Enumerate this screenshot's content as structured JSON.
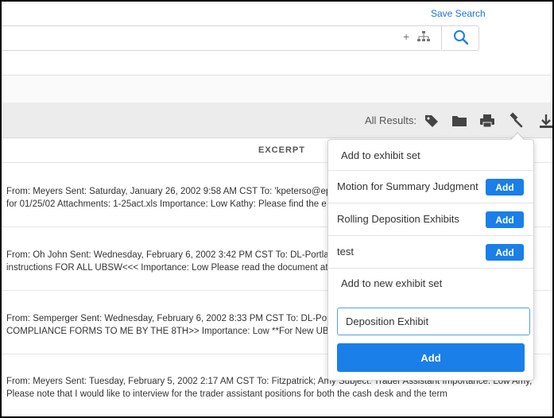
{
  "search": {
    "save_search_label": "Save Search",
    "query": "",
    "tools": {
      "add_symbol": "+"
    }
  },
  "toolbar": {
    "all_results_label": "All Results:",
    "icons": [
      "tags-icon",
      "folder-icon",
      "print-icon",
      "gavel-icon",
      "download-icon"
    ]
  },
  "table": {
    "excerpt_header": "EXCERPT",
    "rows": [
      {
        "line1": "From: Meyers Sent: Saturday, January 26, 2002 9:58 AM CST To: 'kpeterso@epel",
        "line2": "for 01/25/02 Attachments: 1-25act.xls Importance: Low Kathy: Please find the e"
      },
      {
        "line1": "From: Oh John Sent: Wednesday, February 6, 2002 3:42 PM CST To: DL-Portland",
        "line2": "instructions FOR ALL UBSW<<< Importance: Low Please read the document at:"
      },
      {
        "line1": "From: Semperger Sent: Wednesday, February 6, 2002 8:33 PM CST To: DL-Portla",
        "line2": "COMPLIANCE FORMS TO ME BY THE 8TH>> Importance: Low **For New UBS e"
      },
      {
        "line1": "From: Meyers Sent: Tuesday, February 5, 2002 2:17 AM CST To: Fitzpatrick; Amy Subject: Trader Assistant Importance: Low Amy,",
        "line2": "Please note that I would like to interview for the trader assistant positions for both the cash desk and the term"
      }
    ]
  },
  "exhibit_dropdown": {
    "header": "Add to exhibit set",
    "sets": [
      {
        "label": "Motion for Summary Judgment",
        "button": "Add"
      },
      {
        "label": "Rolling Deposition Exhibits",
        "button": "Add"
      },
      {
        "label": "test",
        "button": "Add"
      }
    ],
    "new_set_label": "Add to new exhibit set",
    "new_set_value": "Deposition Exhibit",
    "add_button": "Add"
  },
  "colors": {
    "accent": "#1a7fe8",
    "link": "#1a73d9"
  }
}
